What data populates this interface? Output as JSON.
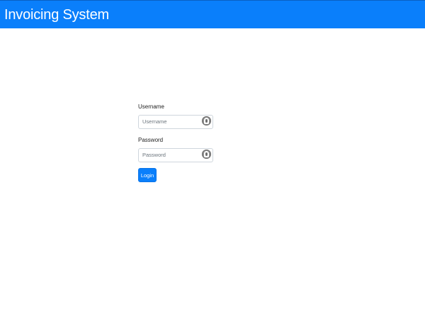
{
  "header": {
    "title": "Invoicing System"
  },
  "login_form": {
    "username": {
      "label": "Username",
      "placeholder": "Username",
      "value": ""
    },
    "password": {
      "label": "Password",
      "placeholder": "Password",
      "value": ""
    },
    "submit_label": "Login"
  },
  "colors": {
    "brand": "#0a7ffb",
    "background": "#ffffff",
    "text": "#222222",
    "input_border": "#cfd6dd"
  },
  "icons": {
    "username_field": "person-icon",
    "password_field": "person-icon"
  }
}
